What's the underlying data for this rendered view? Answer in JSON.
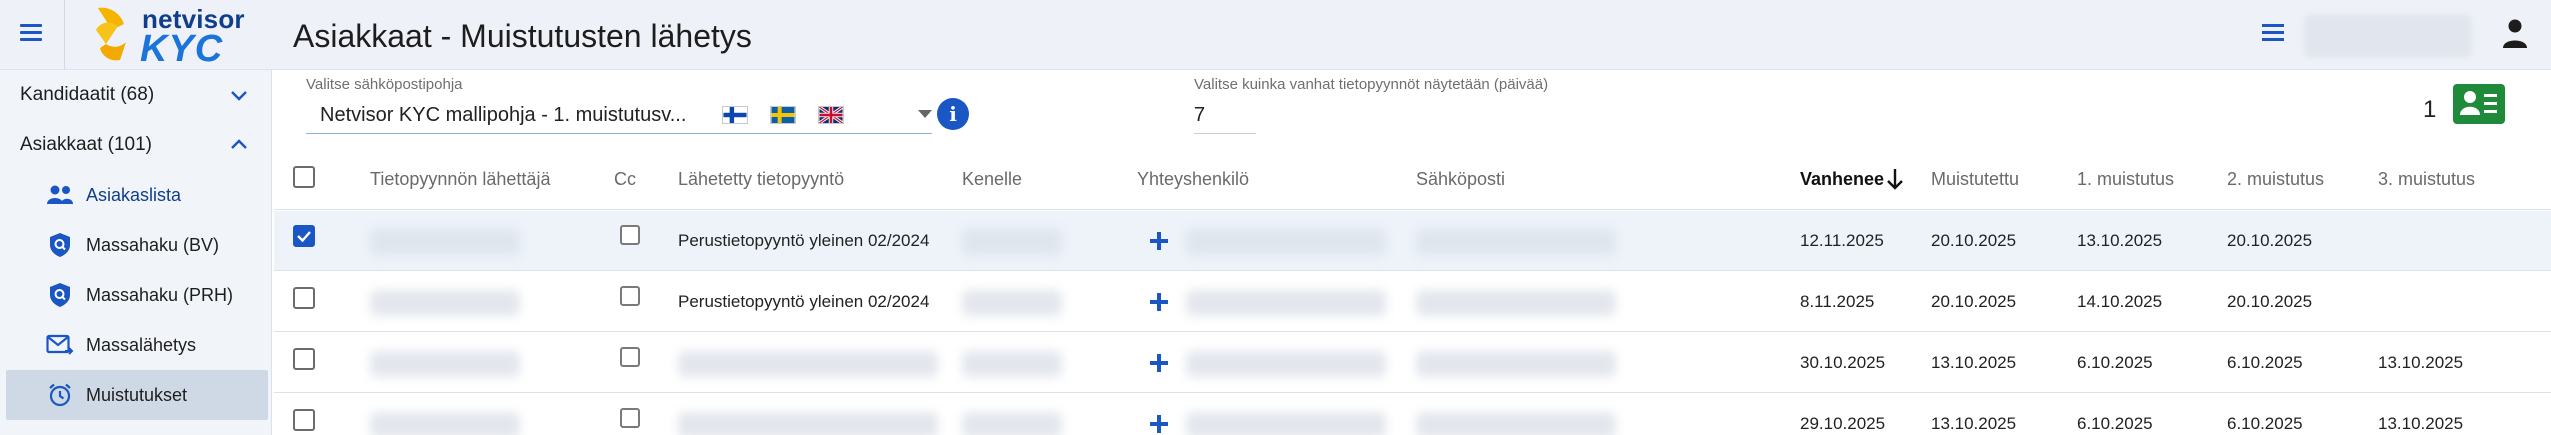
{
  "header": {
    "menu_icon": "menu-icon",
    "logo_brand_top": "netvisor",
    "logo_brand_bottom": "KYC",
    "page_title": "Asiakkaat - Muistutusten lähetys",
    "right_menu_icon": "menu-icon",
    "user_icon": "person-icon"
  },
  "sidebar": {
    "items": [
      {
        "label": "Kandidaatit (68)",
        "icon": "chevron-down-icon"
      },
      {
        "label": "Asiakkaat (101)",
        "icon": "chevron-up-icon"
      }
    ],
    "subitems": [
      {
        "label": "Asiakaslista",
        "icon": "people-icon"
      },
      {
        "label": "Massahaku (BV)",
        "icon": "shield-search-icon"
      },
      {
        "label": "Massahaku (PRH)",
        "icon": "shield-search-icon"
      },
      {
        "label": "Massalähetys",
        "icon": "mail-send-icon"
      },
      {
        "label": "Muistutukset",
        "icon": "alarm-clock-icon",
        "active": true
      }
    ]
  },
  "filters": {
    "template_label": "Valitse sähköpostipohja",
    "template_value": "Netvisor KYC mallipohja - 1. muistutusv...",
    "flags": [
      "finland-flag-icon",
      "sweden-flag-icon",
      "uk-flag-icon"
    ],
    "info_icon": "info-icon",
    "info_glyph": "i",
    "days_label": "Valitse kuinka vanhat tietopyynnöt näytetään (päivää)",
    "days_value": "7",
    "selected_count": "1",
    "contact_card_icon": "contact-card-icon"
  },
  "table": {
    "columns": {
      "sender": "Tietopyynnön lähettäjä",
      "cc": "Cc",
      "sent_request": "Lähetetty tietopyyntö",
      "recipient": "Kenelle",
      "contact": "Yhteyshenkilö",
      "email": "Sähköposti",
      "expires": "Vanhenee",
      "reminded": "Muistutettu",
      "reminder1": "1. muistutus",
      "reminder2": "2. muistutus",
      "reminder3": "3. muistutus"
    },
    "rows": [
      {
        "checked": true,
        "cc": false,
        "sent_request": "Perustietopyyntö yleinen 02/2024",
        "expires": "12.11.2025",
        "reminded": "20.10.2025",
        "reminder1": "13.10.2025",
        "reminder2": "20.10.2025",
        "reminder3": ""
      },
      {
        "checked": false,
        "cc": false,
        "sent_request": "Perustietopyyntö yleinen 02/2024",
        "expires": "8.11.2025",
        "reminded": "20.10.2025",
        "reminder1": "14.10.2025",
        "reminder2": "20.10.2025",
        "reminder3": ""
      },
      {
        "checked": false,
        "cc": false,
        "sent_request": "",
        "expires": "30.10.2025",
        "reminded": "13.10.2025",
        "reminder1": "6.10.2025",
        "reminder2": "6.10.2025",
        "reminder3": "13.10.2025"
      },
      {
        "checked": false,
        "cc": false,
        "sent_request": "",
        "expires": "29.10.2025",
        "reminded": "13.10.2025",
        "reminder1": "6.10.2025",
        "reminder2": "6.10.2025",
        "reminder3": "13.10.2025"
      }
    ]
  }
}
